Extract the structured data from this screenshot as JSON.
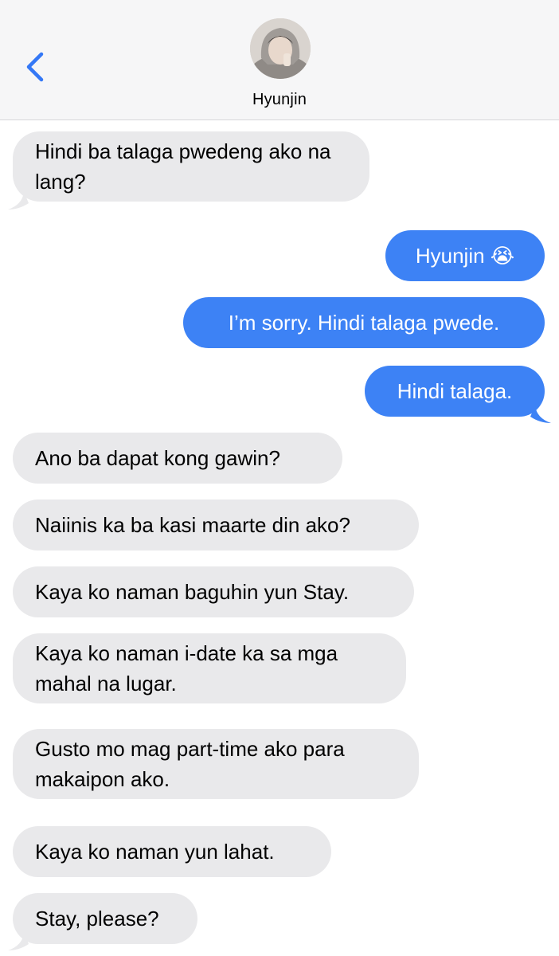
{
  "header": {
    "contact_name": "Hyunjin",
    "back_icon": "chevron-left-icon",
    "avatar": "contact-photo"
  },
  "colors": {
    "incoming_bubble": "#e9e9eb",
    "outgoing_bubble": "#3d82f5",
    "accent": "#3478f6",
    "header_bg": "#f6f6f7"
  },
  "messages": [
    {
      "direction": "incoming",
      "text": "Hindi ba talaga pwedeng ako na lang?"
    },
    {
      "direction": "outgoing",
      "text": "Hyunjin 😭"
    },
    {
      "direction": "outgoing",
      "text": "I’m sorry. Hindi talaga pwede."
    },
    {
      "direction": "outgoing",
      "text": "Hindi talaga."
    },
    {
      "direction": "incoming",
      "text": "Ano ba dapat kong gawin?"
    },
    {
      "direction": "incoming",
      "text": "Naiinis ka ba kasi maarte din ako?"
    },
    {
      "direction": "incoming",
      "text": "Kaya ko naman baguhin yun Stay."
    },
    {
      "direction": "incoming",
      "text": "Kaya ko naman i-date ka sa mga mahal na lugar."
    },
    {
      "direction": "incoming",
      "text": "Gusto mo mag part-time ako para makaipon ako."
    },
    {
      "direction": "incoming",
      "text": "Kaya ko naman yun lahat."
    },
    {
      "direction": "incoming",
      "text": "Stay, please?"
    }
  ]
}
